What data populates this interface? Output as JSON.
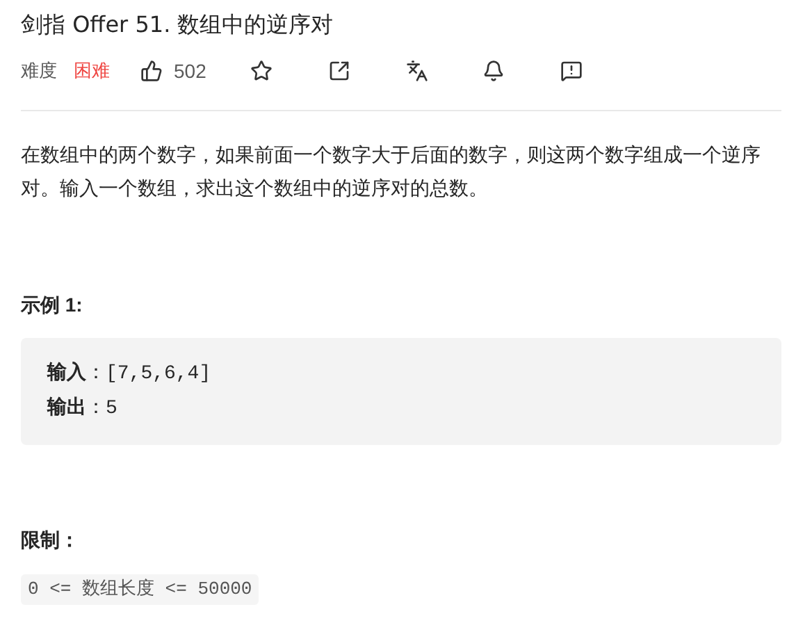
{
  "title": "剑指 Offer 51. 数组中的逆序对",
  "meta": {
    "difficulty_label": "难度",
    "difficulty": {
      "text": "困难",
      "kind": "hard"
    },
    "likes": "502"
  },
  "description": "在数组中的两个数字，如果前面一个数字大于后面的数字，则这两个数字组成一个逆序对。输入一个数组，求出这个数组中的逆序对的总数。",
  "example": {
    "title": "示例 1:",
    "lines": [
      "**输入**：[7,5,6,4]",
      "**输出**：5"
    ]
  },
  "constraints": {
    "title": "限制：",
    "code": "0 <= 数组长度 <= 50000"
  }
}
